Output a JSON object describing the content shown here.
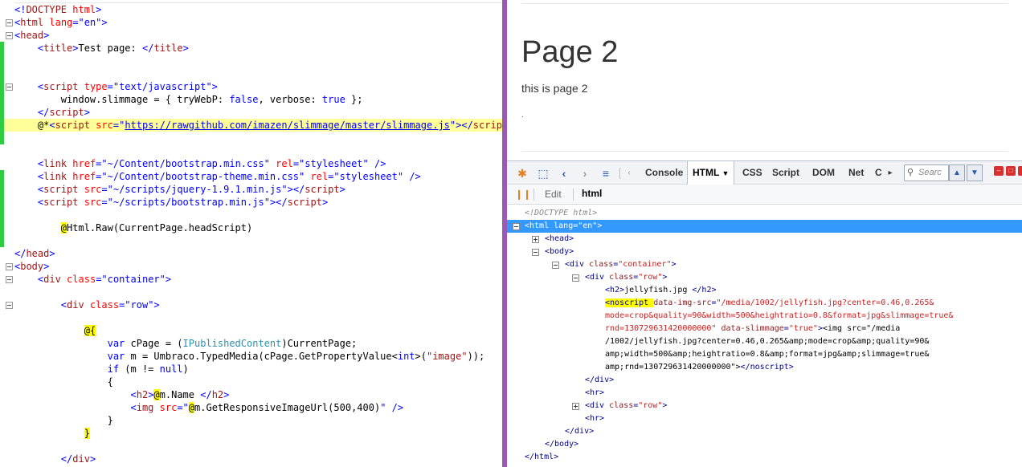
{
  "editor": {
    "lines": [
      [
        {
          "c": "t-br",
          "t": "<!"
        },
        {
          "c": "t-tag",
          "t": "DOCTYPE"
        },
        {
          "c": "t-at",
          "t": " html"
        },
        {
          "c": "t-br",
          "t": ">"
        }
      ],
      [
        {
          "c": "t-br",
          "t": "<"
        },
        {
          "c": "t-tag",
          "t": "html"
        },
        {
          "c": "t-at",
          "t": " lang"
        },
        {
          "c": "t-br",
          "t": "=\"en\">"
        }
      ],
      [
        {
          "c": "t-br",
          "t": "<"
        },
        {
          "c": "t-tag",
          "t": "head"
        },
        {
          "c": "t-br",
          "t": ">"
        }
      ],
      [
        {
          "c": "t-txt",
          "t": "    "
        },
        {
          "c": "t-br",
          "t": "<"
        },
        {
          "c": "t-tag",
          "t": "title"
        },
        {
          "c": "t-br",
          "t": ">"
        },
        {
          "c": "t-txt",
          "t": "Test page: "
        },
        {
          "c": "t-br",
          "t": "</"
        },
        {
          "c": "t-tag",
          "t": "title"
        },
        {
          "c": "t-br",
          "t": ">"
        }
      ],
      [],
      [],
      [
        {
          "c": "t-txt",
          "t": "    "
        },
        {
          "c": "t-br",
          "t": "<"
        },
        {
          "c": "t-tag",
          "t": "script"
        },
        {
          "c": "t-at",
          "t": " type"
        },
        {
          "c": "t-br",
          "t": "=\"text/javascript\">"
        }
      ],
      [
        {
          "c": "t-txt",
          "t": "        window.slimmage = { tryWebP: "
        },
        {
          "c": "t-kw",
          "t": "false"
        },
        {
          "c": "t-txt",
          "t": ", verbose: "
        },
        {
          "c": "t-kw",
          "t": "true"
        },
        {
          "c": "t-txt",
          "t": " };"
        }
      ],
      [
        {
          "c": "t-txt",
          "t": "    "
        },
        {
          "c": "t-br",
          "t": "</"
        },
        {
          "c": "t-tag",
          "t": "script"
        },
        {
          "c": "t-br",
          "t": ">"
        }
      ],
      [
        {
          "c": "t-txt",
          "t": "    @*"
        },
        {
          "c": "t-br",
          "t": "<"
        },
        {
          "c": "t-tag",
          "t": "script"
        },
        {
          "c": "t-at",
          "t": " src"
        },
        {
          "c": "t-br",
          "t": "=\""
        },
        {
          "c": "t-link",
          "t": "https://rawgithub.com/imazen/slimmage/master/slimmage.js"
        },
        {
          "c": "t-br",
          "t": "\"></"
        },
        {
          "c": "t-tag",
          "t": "script"
        },
        {
          "c": "t-br",
          "t": ">"
        },
        {
          "c": "t-txt",
          "t": "*"
        }
      ],
      [],
      [],
      [
        {
          "c": "t-txt",
          "t": "    "
        },
        {
          "c": "t-br",
          "t": "<"
        },
        {
          "c": "t-tag",
          "t": "link"
        },
        {
          "c": "t-at",
          "t": " href"
        },
        {
          "c": "t-br",
          "t": "=\"~/Content/bootstrap.min.css\""
        },
        {
          "c": "t-at",
          "t": " rel"
        },
        {
          "c": "t-br",
          "t": "=\"stylesheet\" />"
        }
      ],
      [
        {
          "c": "t-txt",
          "t": "    "
        },
        {
          "c": "t-br",
          "t": "<"
        },
        {
          "c": "t-tag",
          "t": "link"
        },
        {
          "c": "t-at",
          "t": " href"
        },
        {
          "c": "t-br",
          "t": "=\"~/Content/bootstrap-theme.min.css\""
        },
        {
          "c": "t-at",
          "t": " rel"
        },
        {
          "c": "t-br",
          "t": "=\"stylesheet\" />"
        }
      ],
      [
        {
          "c": "t-txt",
          "t": "    "
        },
        {
          "c": "t-br",
          "t": "<"
        },
        {
          "c": "t-tag",
          "t": "script"
        },
        {
          "c": "t-at",
          "t": " src"
        },
        {
          "c": "t-br",
          "t": "=\"~/scripts/jquery-1.9.1.min.js\"></"
        },
        {
          "c": "t-tag",
          "t": "script"
        },
        {
          "c": "t-br",
          "t": ">"
        }
      ],
      [
        {
          "c": "t-txt",
          "t": "    "
        },
        {
          "c": "t-br",
          "t": "<"
        },
        {
          "c": "t-tag",
          "t": "script"
        },
        {
          "c": "t-at",
          "t": " src"
        },
        {
          "c": "t-br",
          "t": "=\"~/scripts/bootstrap.min.js\"></"
        },
        {
          "c": "t-tag",
          "t": "script"
        },
        {
          "c": "t-br",
          "t": ">"
        }
      ],
      [],
      [
        {
          "c": "t-txt",
          "t": "        "
        },
        {
          "c": "t-razor",
          "t": "@"
        },
        {
          "c": "t-txt",
          "t": "Html.Raw(CurrentPage.headScript)"
        }
      ],
      [],
      [
        {
          "c": "t-br",
          "t": "</"
        },
        {
          "c": "t-tag",
          "t": "head"
        },
        {
          "c": "t-br",
          "t": ">"
        }
      ],
      [
        {
          "c": "t-br",
          "t": "<"
        },
        {
          "c": "t-tag",
          "t": "body"
        },
        {
          "c": "t-br",
          "t": ">"
        }
      ],
      [
        {
          "c": "t-txt",
          "t": "    "
        },
        {
          "c": "t-br",
          "t": "<"
        },
        {
          "c": "t-tag",
          "t": "div"
        },
        {
          "c": "t-at",
          "t": " class"
        },
        {
          "c": "t-br",
          "t": "=\"container\">"
        }
      ],
      [],
      [
        {
          "c": "t-txt",
          "t": "        "
        },
        {
          "c": "t-br",
          "t": "<"
        },
        {
          "c": "t-tag",
          "t": "div"
        },
        {
          "c": "t-at",
          "t": " class"
        },
        {
          "c": "t-br",
          "t": "=\"row\">"
        }
      ],
      [],
      [
        {
          "c": "t-txt",
          "t": "            "
        },
        {
          "c": "t-razor",
          "t": "@{"
        }
      ],
      [
        {
          "c": "t-txt",
          "t": "                "
        },
        {
          "c": "t-kw",
          "t": "var"
        },
        {
          "c": "t-txt",
          "t": " cPage = ("
        },
        {
          "c": "t-type",
          "t": "IPublishedContent"
        },
        {
          "c": "t-txt",
          "t": ")CurrentPage;"
        }
      ],
      [
        {
          "c": "t-txt",
          "t": "                "
        },
        {
          "c": "t-kw",
          "t": "var"
        },
        {
          "c": "t-txt",
          "t": " m = Umbraco.TypedMedia(cPage.GetPropertyValue<"
        },
        {
          "c": "t-kw",
          "t": "int"
        },
        {
          "c": "t-txt",
          "t": ">("
        },
        {
          "c": "t-cs",
          "t": "\"image\""
        },
        {
          "c": "t-txt",
          "t": "));"
        }
      ],
      [
        {
          "c": "t-txt",
          "t": "                "
        },
        {
          "c": "t-kw",
          "t": "if"
        },
        {
          "c": "t-txt",
          "t": " (m != "
        },
        {
          "c": "t-kw",
          "t": "null"
        },
        {
          "c": "t-txt",
          "t": ")"
        }
      ],
      [
        {
          "c": "t-txt",
          "t": "                {"
        }
      ],
      [
        {
          "c": "t-txt",
          "t": "                    "
        },
        {
          "c": "t-br",
          "t": "<"
        },
        {
          "c": "t-tag",
          "t": "h2"
        },
        {
          "c": "t-br",
          "t": ">"
        },
        {
          "c": "t-razor",
          "t": "@"
        },
        {
          "c": "t-txt",
          "t": "m.Name "
        },
        {
          "c": "t-br",
          "t": "</"
        },
        {
          "c": "t-tag",
          "t": "h2"
        },
        {
          "c": "t-br",
          "t": ">"
        }
      ],
      [
        {
          "c": "t-txt",
          "t": "                    "
        },
        {
          "c": "t-br",
          "t": "<"
        },
        {
          "c": "t-tag",
          "t": "img"
        },
        {
          "c": "t-at",
          "t": " src"
        },
        {
          "c": "t-br",
          "t": "=\""
        },
        {
          "c": "t-razor",
          "t": "@"
        },
        {
          "c": "t-txt",
          "t": "m.GetResponsiveImageUrl(500,400)"
        },
        {
          "c": "t-br",
          "t": "\" />"
        }
      ],
      [
        {
          "c": "t-txt",
          "t": "                }"
        }
      ],
      [
        {
          "c": "t-txt",
          "t": "            "
        },
        {
          "c": "t-razor",
          "t": "}"
        }
      ],
      [],
      [
        {
          "c": "t-txt",
          "t": "        "
        },
        {
          "c": "t-br",
          "t": "</"
        },
        {
          "c": "t-tag",
          "t": "div"
        },
        {
          "c": "t-br",
          "t": ">"
        }
      ]
    ]
  },
  "page": {
    "title": "Page 2",
    "text": "this is page 2",
    "dot": "."
  },
  "firebug": {
    "tabs": [
      "Console",
      "HTML",
      "CSS",
      "Script",
      "DOM",
      "Net",
      "C"
    ],
    "active_tab": "HTML",
    "search_placeholder": "Searc",
    "edit_label": "Edit",
    "breadcrumb": "html",
    "tree": [
      [
        {
          "c": "f-doc",
          "t": "<!DOCTYPE html>"
        }
      ],
      [
        {
          "c": "f-tag",
          "t": "<html"
        },
        {
          "c": "f-at",
          "t": " lang"
        },
        {
          "c": "f-tag",
          "t": "="
        },
        {
          "c": "f-str",
          "t": "\"en\""
        },
        {
          "c": "f-tag",
          "t": ">"
        }
      ],
      [
        {
          "c": "f-tag",
          "t": "<head>"
        }
      ],
      [
        {
          "c": "f-tag",
          "t": "<body>"
        }
      ],
      [
        {
          "c": "f-tag",
          "t": "<div"
        },
        {
          "c": "f-at",
          "t": " class"
        },
        {
          "c": "f-tag",
          "t": "="
        },
        {
          "c": "f-str",
          "t": "\"container\""
        },
        {
          "c": "f-tag",
          "t": ">"
        }
      ],
      [
        {
          "c": "f-tag",
          "t": "<div"
        },
        {
          "c": "f-at",
          "t": " class"
        },
        {
          "c": "f-tag",
          "t": "="
        },
        {
          "c": "f-str",
          "t": "\"row\""
        },
        {
          "c": "f-tag",
          "t": ">"
        }
      ],
      [
        {
          "c": "f-tag",
          "t": "<h2>"
        },
        {
          "c": "f-txt",
          "t": "jellyfish.jpg "
        },
        {
          "c": "f-tag",
          "t": "</h2>"
        }
      ],
      [
        {
          "c": "f-tag f-hl",
          "t": "<noscript "
        },
        {
          "c": "f-at",
          "t": "data-img-src"
        },
        {
          "c": "f-tag",
          "t": "="
        },
        {
          "c": "f-str",
          "t": "\"/media/1002/jellyfish.jpg?center=0.46,0.265&"
        }
      ],
      [
        {
          "c": "f-str",
          "t": "mode=crop&quality=90&width=500&heightratio=0.8&format=jpg&slimmage=true&"
        }
      ],
      [
        {
          "c": "f-str",
          "t": "rnd=130729631420000000\""
        },
        {
          "c": "f-at",
          "t": " data-slimmage"
        },
        {
          "c": "f-tag",
          "t": "="
        },
        {
          "c": "f-str",
          "t": "\"true\""
        },
        {
          "c": "f-tag",
          "t": ">"
        },
        {
          "c": "f-txt",
          "t": "<img src=\"/media"
        }
      ],
      [
        {
          "c": "f-txt",
          "t": "/1002/jellyfish.jpg?center=0.46,0.265&amp;mode=crop&amp;quality=90&"
        }
      ],
      [
        {
          "c": "f-txt",
          "t": "amp;width=500&amp;heightratio=0.8&amp;format=jpg&amp;slimmage=true&"
        }
      ],
      [
        {
          "c": "f-txt",
          "t": "amp;rnd=130729631420000000\">"
        },
        {
          "c": "f-tag",
          "t": "</noscript>"
        }
      ],
      [
        {
          "c": "f-tag",
          "t": "</div>"
        }
      ],
      [
        {
          "c": "f-tag",
          "t": "<hr>"
        }
      ],
      [
        {
          "c": "f-tag",
          "t": "<div"
        },
        {
          "c": "f-at",
          "t": " class"
        },
        {
          "c": "f-tag",
          "t": "="
        },
        {
          "c": "f-str",
          "t": "\"row\""
        },
        {
          "c": "f-tag",
          "t": ">"
        }
      ],
      [
        {
          "c": "f-tag",
          "t": "<hr>"
        }
      ],
      [
        {
          "c": "f-tag",
          "t": "</div>"
        }
      ],
      [
        {
          "c": "f-tag",
          "t": "</body>"
        }
      ],
      [
        {
          "c": "f-tag",
          "t": "</html>"
        }
      ]
    ]
  },
  "colors": {
    "divider": "#9b59b6",
    "gutter_green": "#2ecc40",
    "highlight": "#ffff99",
    "selection": "#3399ff"
  }
}
